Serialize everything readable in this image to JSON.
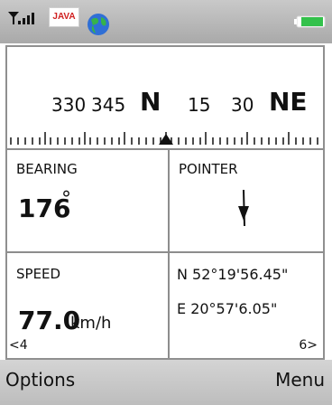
{
  "statusbar": {
    "signal_icon": "signal-icon",
    "java_label": "JAVA",
    "globe_icon": "globe-icon",
    "battery_icon": "battery-icon"
  },
  "compass": {
    "labels": [
      "330",
      "345",
      "N",
      "15",
      "30",
      "NE"
    ]
  },
  "bearing": {
    "label": "BEARING",
    "value": "176",
    "unit": "°"
  },
  "pointer": {
    "label": "POINTER"
  },
  "speed": {
    "label": "SPEED",
    "value": "77.0",
    "unit": "km/h"
  },
  "coords": {
    "lat": "N 52°19'56.45\"",
    "lon": "E 20°57'6.05\""
  },
  "page": {
    "left": "<4",
    "right": "6>"
  },
  "softkeys": {
    "left": "Options",
    "right": "Menu"
  }
}
